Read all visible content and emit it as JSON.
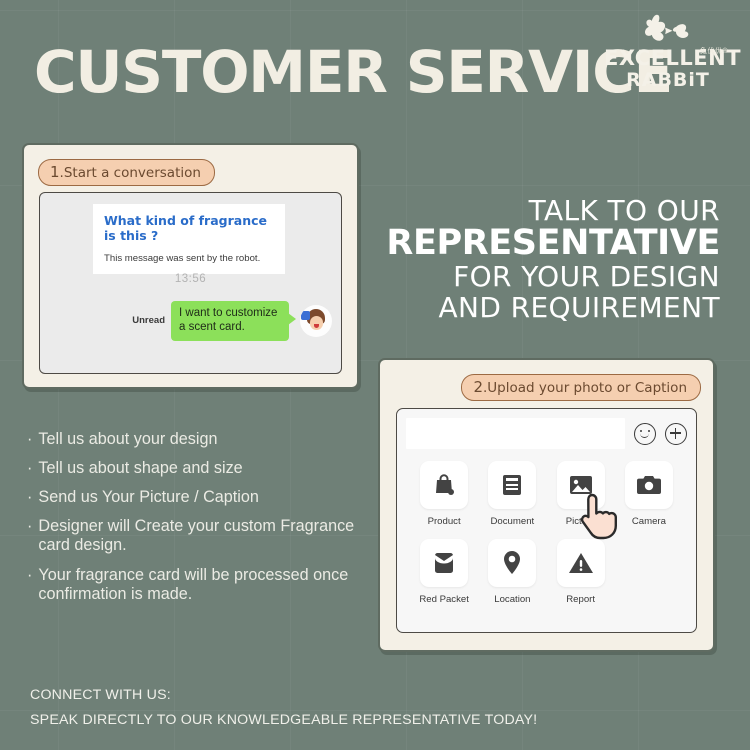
{
  "theme": {
    "background": "#6f8077",
    "card_cream": "#f4f0e6",
    "card_border": "#5f6b61",
    "badge_fill": "#f5cfb0",
    "badge_border": "#9c6a43",
    "badge_text": "#6b4a30",
    "heading_cream": "#f2eee3",
    "white": "#ffffff",
    "bot_title_blue": "#2a6cc9",
    "user_bubble_green": "#8ce05a"
  },
  "header": {
    "title": "CUSTOMER SERVICE"
  },
  "logo": {
    "icon": "rabbit-icon",
    "line1": "EXCELLENT",
    "line2": "RABBiT",
    "chinese_mark": "兔优优®"
  },
  "chat_card": {
    "step_number": "1",
    "step_separator": ".",
    "step_label": "Start a conversation",
    "bot_message": {
      "title": "What kind of fragrance is this ?",
      "subtitle": "This message was sent by the robot."
    },
    "timestamp": "13:56",
    "unread_label": "Unread",
    "user_message": "I want to customize a scent card.",
    "avatar": "user-avatar"
  },
  "headline": {
    "line1": "TALK TO OUR",
    "line2": "REPRESENTATIVE",
    "line3": "FOR YOUR DESIGN",
    "line4": "AND REQUIREMENT"
  },
  "bullets": {
    "marker": "·",
    "items": [
      "Tell us about your design",
      "Tell us about shape and size",
      "Send us Your Picture / Caption",
      "Designer will Create your custom Fragrance card design.",
      "Your fragrance card will be processed once confirmation is made."
    ]
  },
  "upload_card": {
    "step_number": "2",
    "step_separator": ".",
    "step_label": "Upload your photo or Caption",
    "input_placeholder": "",
    "input_value": "",
    "actions": [
      {
        "label": "Product",
        "icon": "shopping-bag-icon"
      },
      {
        "label": "Document",
        "icon": "document-icon"
      },
      {
        "label": "Picture",
        "icon": "picture-icon"
      },
      {
        "label": "Camera",
        "icon": "camera-icon"
      },
      {
        "label": "Red Packet",
        "icon": "red-packet-icon"
      },
      {
        "label": "Location",
        "icon": "location-pin-icon"
      },
      {
        "label": "Report",
        "icon": "warning-triangle-icon"
      }
    ],
    "emoji_icon": "smiley-icon",
    "plus_icon": "plus-circle-icon",
    "cursor": "pointing-hand-cursor"
  },
  "footer": {
    "line1": "CONNECT WITH US:",
    "line2": "SPEAK DIRECTLY TO OUR KNOWLEDGEABLE REPRESENTATIVE TODAY!"
  }
}
